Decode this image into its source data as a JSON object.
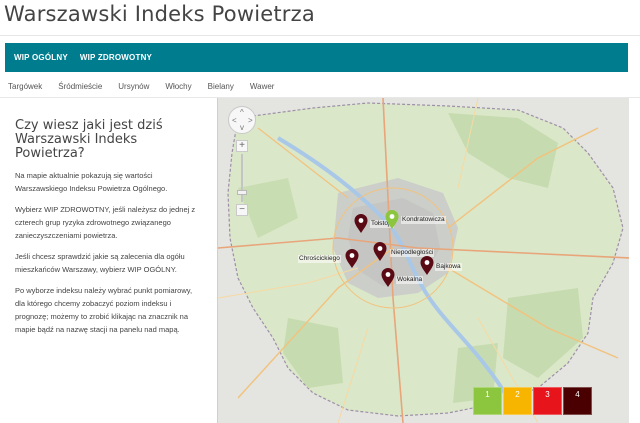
{
  "site": {
    "title": "Warszawski Indeks Powietrza"
  },
  "nav": {
    "items": [
      "WIP OGÓLNY",
      "WIP ZDROWOTNY"
    ]
  },
  "districts": [
    "Targówek",
    "Śródmieście",
    "Ursynów",
    "Włochy",
    "Bielany",
    "Wawer"
  ],
  "info": {
    "heading": "Czy wiesz jaki jest dziś Warszawski Indeks Powietrza?",
    "paragraphs": [
      "Na mapie aktualnie pokazują się wartości Warszawskiego Indeksu Powietrza Ogólnego.",
      "Wybierz WIP ZDROWOTNY, jeśli należysz do jednej z czterech grup ryzyka zdrowotnego związanego zanieczyszczeniami powietrza.",
      "Jeśli chcesz sprawdzić jakie są zalecenia dla ogółu mieszkańców Warszawy, wybierz WIP OGÓLNY.",
      "Po wyborze indeksu należy wybrać punkt pomiarowy, dla którego chcemy zobaczyć poziom indeksu i prognozę; możemy to zrobić klikając na znacznik na mapie bądź na nazwę stacji na panelu nad mapą."
    ]
  },
  "map": {
    "controls": {
      "zoom_in": "+",
      "zoom_out": "−",
      "pan_up": "^",
      "pan_down": "v",
      "pan_left": "<",
      "pan_right": ">"
    },
    "stations": [
      {
        "name": "Tołstoja",
        "level": 4
      },
      {
        "name": "Kondratowicza",
        "level": 1
      },
      {
        "name": "Niepodległości",
        "level": 4
      },
      {
        "name": "Chrościckiego",
        "level": 4
      },
      {
        "name": "Bajkowa",
        "level": 4
      },
      {
        "name": "Wokalna",
        "level": 4
      }
    ],
    "legend": [
      {
        "label": "1",
        "color": "#8cc63f"
      },
      {
        "label": "2",
        "color": "#f7b500"
      },
      {
        "label": "3",
        "color": "#e8141b"
      },
      {
        "label": "4",
        "color": "#4a0000"
      }
    ],
    "marker_colors": {
      "1": "#8cc63f",
      "4": "#5a0a14"
    }
  }
}
